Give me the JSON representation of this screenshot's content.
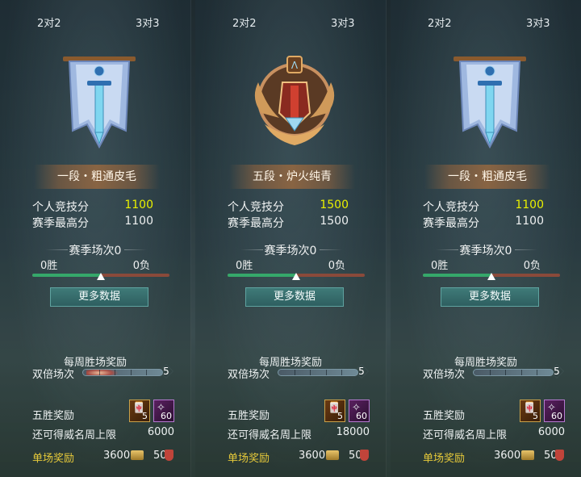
{
  "panels": [
    {
      "modes": [
        "2对2",
        "3对3"
      ],
      "emblem_icon": "blue-sword-banner-icon",
      "rank_name": "一段・粗通皮毛",
      "stats": [
        {
          "label": "个人竞技分",
          "value": "1100"
        },
        {
          "label": "赛季最高分",
          "value": "1100"
        }
      ],
      "season_title": "赛季场次0",
      "wins": "0胜",
      "losses": "0负",
      "more_button": "更多数据",
      "weekly_title": "每周胜场奖励",
      "double_label": "双倍场次",
      "double_count": "5",
      "five_win_label": "五胜奖励",
      "items": [
        {
          "icon": "orange-crate-icon",
          "count": "5"
        },
        {
          "icon": "purple-gem-icon",
          "count": "60"
        }
      ],
      "cap_label": "还可得威名周上限",
      "cap_value": "6000",
      "single_label": "单场奖励",
      "single_coins": "3600",
      "single_shields": "50"
    },
    {
      "modes": [
        "2对2",
        "3对3"
      ],
      "emblem_icon": "bronze-winged-shield-icon",
      "rank_name": "五段・炉火纯青",
      "stats": [
        {
          "label": "个人竞技分",
          "value": "1500"
        },
        {
          "label": "赛季最高分",
          "value": "1500"
        }
      ],
      "season_title": "赛季场次0",
      "wins": "0胜",
      "losses": "0负",
      "more_button": "更多数据",
      "weekly_title": "每周胜场奖励",
      "double_label": "双倍场次",
      "double_count": "5",
      "five_win_label": "五胜奖励",
      "items": [
        {
          "icon": "orange-crate-icon",
          "count": "5"
        },
        {
          "icon": "purple-gem-icon",
          "count": "60"
        }
      ],
      "cap_label": "还可得威名周上限",
      "cap_value": "18000",
      "single_label": "单场奖励",
      "single_coins": "3600",
      "single_shields": "50"
    },
    {
      "modes": [
        "2对2",
        "3对3"
      ],
      "emblem_icon": "blue-sword-banner-icon",
      "rank_name": "一段・粗通皮毛",
      "stats": [
        {
          "label": "个人竞技分",
          "value": "1100"
        },
        {
          "label": "赛季最高分",
          "value": "1100"
        }
      ],
      "season_title": "赛季场次0",
      "wins": "0胜",
      "losses": "0负",
      "more_button": "更多数据",
      "weekly_title": "每周胜场奖励",
      "double_label": "双倍场次",
      "double_count": "5",
      "five_win_label": "五胜奖励",
      "items": [
        {
          "icon": "orange-crate-icon",
          "count": "5"
        },
        {
          "icon": "purple-gem-icon",
          "count": "60"
        }
      ],
      "cap_label": "还可得威名周上限",
      "cap_value": "6000",
      "single_label": "单场奖励",
      "single_coins": "3600",
      "single_shields": "50"
    }
  ],
  "colors": {
    "score_highlight": "#e9f000",
    "single_reward_label": "#e6c93a",
    "win_bar": "#35a86a",
    "loss_bar": "#8a4a3a",
    "button": "#3f7a78"
  }
}
